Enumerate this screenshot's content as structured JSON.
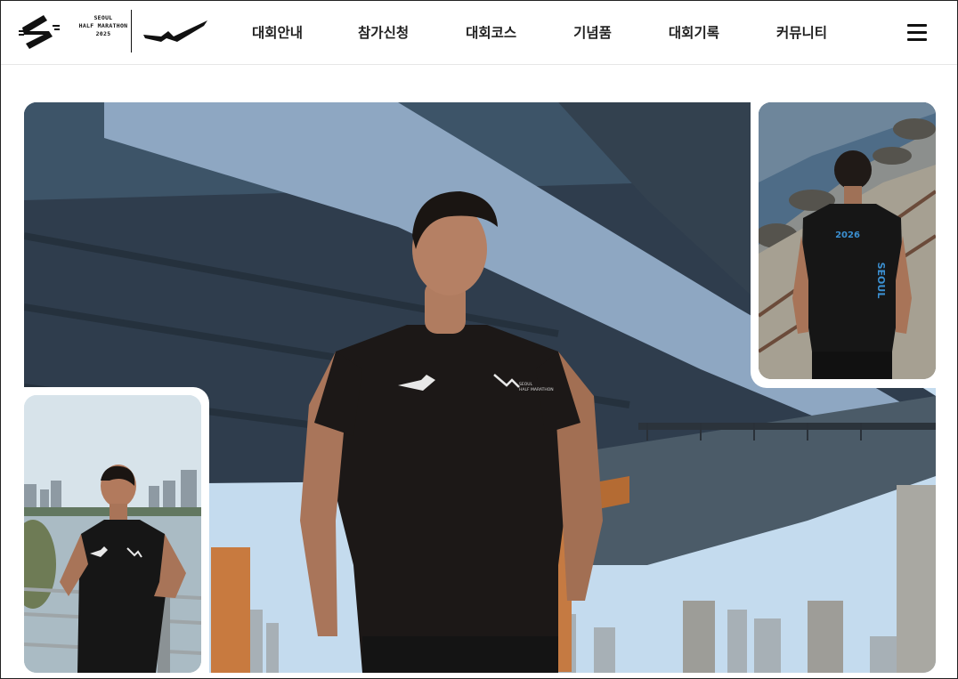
{
  "header": {
    "logo": {
      "name": "seoul-half-marathon-logo",
      "lines": [
        "SEOUL",
        "HALF MARATHON",
        "2025"
      ]
    },
    "partner_logo": "partner-brand-logo",
    "nav": [
      {
        "label": "대회안내"
      },
      {
        "label": "참가신청"
      },
      {
        "label": "대회코스"
      },
      {
        "label": "기념품"
      },
      {
        "label": "대회기록"
      },
      {
        "label": "커뮤니티"
      }
    ],
    "menu_icon": "hamburger-menu-icon"
  },
  "gallery": {
    "main_image": "runner-under-bridge-photo",
    "top_right_image": "runner-back-view-photo",
    "bottom_left_image": "runner-riverside-photo",
    "back_print_text": [
      "2026",
      "SEOUL"
    ]
  },
  "colors": {
    "accent_blue": "#3b8fd0",
    "text": "#222222",
    "shirt": "#1a1716"
  }
}
